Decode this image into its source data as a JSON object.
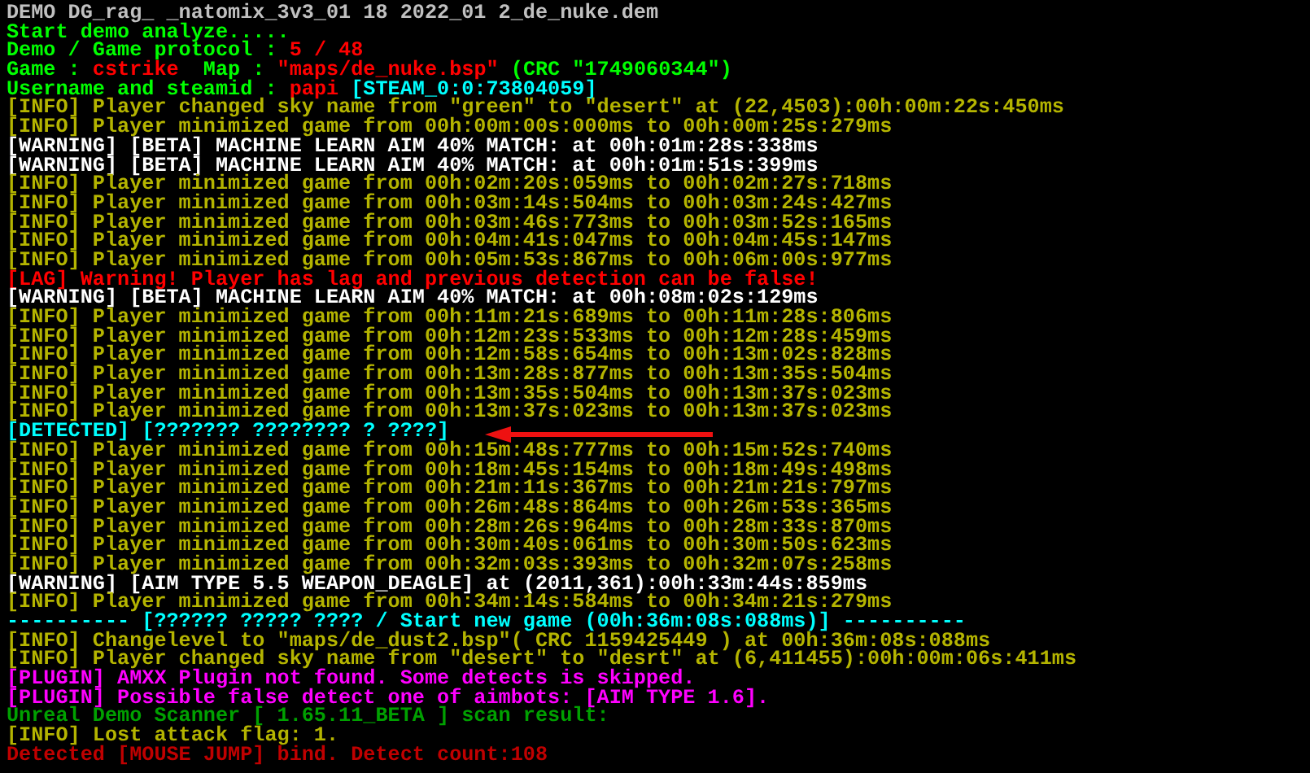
{
  "console_lines": [
    {
      "segments": [
        {
          "text": "DEMO DG_rag_ _natomix_3v3_01 18 2022_01 2_de_nuke.dem",
          "color": "#c0c0c0"
        }
      ]
    },
    {
      "segments": [
        {
          "text": "Start demo analyze.....",
          "color": "#00ff00"
        }
      ]
    },
    {
      "segments": [
        {
          "text": "Demo / Game protocol : ",
          "color": "#00ff00"
        },
        {
          "text": "5 / 48",
          "color": "#ff0000"
        }
      ]
    },
    {
      "segments": [
        {
          "text": "Game : ",
          "color": "#00ff00"
        },
        {
          "text": "cstrike",
          "color": "#ff0000"
        },
        {
          "text": "  Map : ",
          "color": "#00ff00"
        },
        {
          "text": "\"maps/de_nuke.bsp\"",
          "color": "#ff0000"
        },
        {
          "text": " (CRC \"1749060344\")",
          "color": "#00ff00"
        }
      ]
    },
    {
      "segments": [
        {
          "text": "Username and steamid : ",
          "color": "#00ff00"
        },
        {
          "text": "papi",
          "color": "#ff0000"
        },
        {
          "text": " [STEAM_0:0:73804059]",
          "color": "#00ffff"
        }
      ]
    },
    {
      "segments": [
        {
          "text": "[INFO] Player changed sky name from \"green\" to \"desert\" at (22,4503):00h:00m:22s:450ms",
          "color": "#b4b400"
        }
      ]
    },
    {
      "segments": [
        {
          "text": "[INFO] Player minimized game from 00h:00m:00s:000ms to 00h:00m:25s:279ms",
          "color": "#b4b400"
        }
      ]
    },
    {
      "segments": [
        {
          "text": "[WARNING] [BETA] MACHINE LEARN AIM 40% MATCH: at 00h:01m:28s:338ms",
          "color": "#ffffff"
        }
      ]
    },
    {
      "segments": [
        {
          "text": "[WARNING] [BETA] MACHINE LEARN AIM 40% MATCH: at 00h:01m:51s:399ms",
          "color": "#ffffff"
        }
      ]
    },
    {
      "segments": [
        {
          "text": "[INFO] Player minimized game from 00h:02m:20s:059ms to 00h:02m:27s:718ms",
          "color": "#b4b400"
        }
      ]
    },
    {
      "segments": [
        {
          "text": "[INFO] Player minimized game from 00h:03m:14s:504ms to 00h:03m:24s:427ms",
          "color": "#b4b400"
        }
      ]
    },
    {
      "segments": [
        {
          "text": "[INFO] Player minimized game from 00h:03m:46s:773ms to 00h:03m:52s:165ms",
          "color": "#b4b400"
        }
      ]
    },
    {
      "segments": [
        {
          "text": "[INFO] Player minimized game from 00h:04m:41s:047ms to 00h:04m:45s:147ms",
          "color": "#b4b400"
        }
      ]
    },
    {
      "segments": [
        {
          "text": "[INFO] Player minimized game from 00h:05m:53s:867ms to 00h:06m:00s:977ms",
          "color": "#b4b400"
        }
      ]
    },
    {
      "segments": [
        {
          "text": "[LAG] Warning! Player has lag and previous detection can be false!",
          "color": "#ff0000"
        }
      ]
    },
    {
      "segments": [
        {
          "text": "[WARNING] [BETA] MACHINE LEARN AIM 40% MATCH: at 00h:08m:02s:129ms",
          "color": "#ffffff"
        }
      ]
    },
    {
      "segments": [
        {
          "text": "[INFO] Player minimized game from 00h:11m:21s:689ms to 00h:11m:28s:806ms",
          "color": "#b4b400"
        }
      ]
    },
    {
      "segments": [
        {
          "text": "[INFO] Player minimized game from 00h:12m:23s:533ms to 00h:12m:28s:459ms",
          "color": "#b4b400"
        }
      ]
    },
    {
      "segments": [
        {
          "text": "[INFO] Player minimized game from 00h:12m:58s:654ms to 00h:13m:02s:828ms",
          "color": "#b4b400"
        }
      ]
    },
    {
      "segments": [
        {
          "text": "[INFO] Player minimized game from 00h:13m:28s:877ms to 00h:13m:35s:504ms",
          "color": "#b4b400"
        }
      ]
    },
    {
      "segments": [
        {
          "text": "[INFO] Player minimized game from 00h:13m:35s:504ms to 00h:13m:37s:023ms",
          "color": "#b4b400"
        }
      ]
    },
    {
      "segments": [
        {
          "text": "[INFO] Player minimized game from 00h:13m:37s:023ms to 00h:13m:37s:023ms",
          "color": "#b4b400"
        }
      ]
    },
    {
      "segments": [
        {
          "text": "[DETECTED] [??????? ???????? ? ????]",
          "color": "#00ffff"
        }
      ]
    },
    {
      "segments": [
        {
          "text": "[INFO] Player minimized game from 00h:15m:48s:777ms to 00h:15m:52s:740ms",
          "color": "#b4b400"
        }
      ]
    },
    {
      "segments": [
        {
          "text": "[INFO] Player minimized game from 00h:18m:45s:154ms to 00h:18m:49s:498ms",
          "color": "#b4b400"
        }
      ]
    },
    {
      "segments": [
        {
          "text": "[INFO] Player minimized game from 00h:21m:11s:367ms to 00h:21m:21s:797ms",
          "color": "#b4b400"
        }
      ]
    },
    {
      "segments": [
        {
          "text": "[INFO] Player minimized game from 00h:26m:48s:864ms to 00h:26m:53s:365ms",
          "color": "#b4b400"
        }
      ]
    },
    {
      "segments": [
        {
          "text": "[INFO] Player minimized game from 00h:28m:26s:964ms to 00h:28m:33s:870ms",
          "color": "#b4b400"
        }
      ]
    },
    {
      "segments": [
        {
          "text": "[INFO] Player minimized game from 00h:30m:40s:061ms to 00h:30m:50s:623ms",
          "color": "#b4b400"
        }
      ]
    },
    {
      "segments": [
        {
          "text": "[INFO] Player minimized game from 00h:32m:03s:393ms to 00h:32m:07s:258ms",
          "color": "#b4b400"
        }
      ]
    },
    {
      "segments": [
        {
          "text": "[WARNING] [AIM TYPE 5.5 WEAPON_DEAGLE] at (2011,361):00h:33m:44s:859ms",
          "color": "#ffffff"
        }
      ]
    },
    {
      "segments": [
        {
          "text": "[INFO] Player minimized game from 00h:34m:14s:584ms to 00h:34m:21s:279ms",
          "color": "#b4b400"
        }
      ]
    },
    {
      "segments": [
        {
          "text": "---------- [?????? ????? ???? / Start new game (00h:36m:08s:088ms)] ----------",
          "color": "#00ffff"
        }
      ]
    },
    {
      "segments": [
        {
          "text": "[INFO] Changelevel to \"maps/de_dust2.bsp\"( CRC 1159425449 ) at 00h:36m:08s:088ms",
          "color": "#b4b400"
        }
      ]
    },
    {
      "segments": [
        {
          "text": "[INFO] Player changed sky name from \"desert\" to \"desrt\" at (6,411455):00h:00m:06s:411ms",
          "color": "#b4b400"
        }
      ]
    },
    {
      "segments": [
        {
          "text": "[PLUGIN] AMXX Plugin not found. Some detects is skipped.",
          "color": "#ff00ff"
        }
      ]
    },
    {
      "segments": [
        {
          "text": "[PLUGIN] Possible false detect one of aimbots: [AIM TYPE 1.6].",
          "color": "#ff00ff"
        }
      ]
    },
    {
      "segments": [
        {
          "text": "Unreal Demo Scanner [ 1.65.11_BETA ] scan result:",
          "color": "#00a000"
        }
      ]
    },
    {
      "segments": [
        {
          "text": "[INFO] Lost attack flag: 1.",
          "color": "#b4b400"
        }
      ]
    },
    {
      "segments": [
        {
          "text": "Detected [MOUSE JUMP] bind. Detect count:108",
          "color": "#c00000"
        }
      ]
    }
  ]
}
